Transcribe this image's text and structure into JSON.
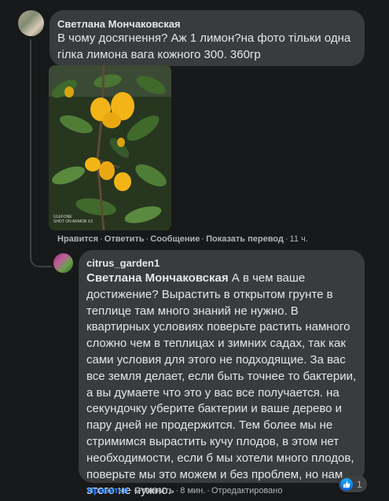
{
  "comment1": {
    "author": "Светлана Мончаковская",
    "text": "В чому досягнення? Аж 1 лимон?на фото тільки одна гілка лимона вага кожного 300. 360гр",
    "photo_watermark_line1": "ULEFONE",
    "photo_watermark_line2": "SHOT ON ARMOR X3",
    "actions": {
      "like": "Нравится",
      "reply": "Ответить",
      "message": "Сообщение",
      "translate": "Показать перевод",
      "time": "11 ч."
    }
  },
  "comment2": {
    "author": "citrus_garden1",
    "mention": "Светлана Мончаковская",
    "text": " А в чем ваше достижение? Вырастить в открытом грунте в теплице там много знаний не нужно. В квартирных условиях поверьте растить намного сложно чем в теплицах и зимних садах, так как сами условия для этого не подходящие. За вас все земля делает, если быть точнее то бактерии, а вы думаете что это у вас все получается. на секундочку уберите бактерии и ваше дерево и пару дней не продержится. Тем более мы не стримимся вырастить кучу плодов, в этом нет необходимости, если б мы хотели много плодов, поверьте мы это можем и без проблем, но нам этого не нужно.",
    "reactions": {
      "icon": "like-icon",
      "count": "1"
    },
    "actions": {
      "like": "Нравится",
      "reply": "Ответить",
      "time": "8 мин.",
      "edited": "Отредактировано"
    }
  },
  "colors": {
    "background": "#18191a",
    "bubble": "#3a3b3c",
    "text": "#e4e6eb",
    "secondary": "#b0b3b8",
    "accent": "#2d88ff"
  }
}
